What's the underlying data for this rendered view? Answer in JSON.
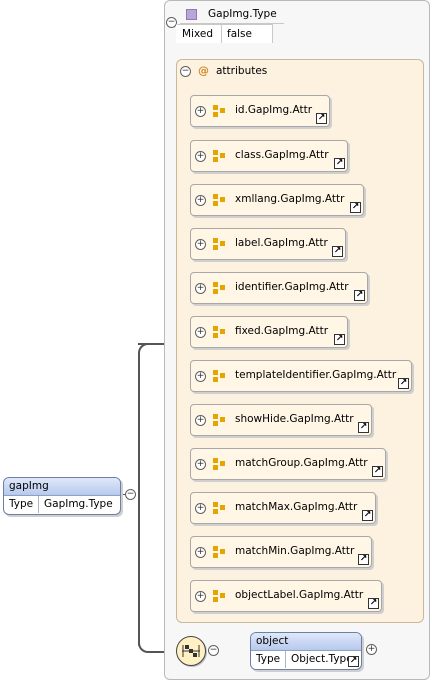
{
  "type_box": {
    "title": "GapImg.Type",
    "mixed_label": "Mixed",
    "mixed_value": "false"
  },
  "attributes": {
    "header": "attributes",
    "at_symbol": "@",
    "items": [
      "id.GapImg.Attr",
      "class.GapImg.Attr",
      "xmllang.GapImg.Attr",
      "label.GapImg.Attr",
      "identifier.GapImg.Attr",
      "fixed.GapImg.Attr",
      "templateIdentifier.GapImg.Attr",
      "showHide.GapImg.Attr",
      "matchGroup.GapImg.Attr",
      "matchMax.GapImg.Attr",
      "matchMin.GapImg.Attr",
      "objectLabel.GapImg.Attr"
    ]
  },
  "root_element": {
    "name": "gapImg",
    "type_label": "Type",
    "type_value": "GapImg.Type"
  },
  "child_element": {
    "name": "object",
    "type_label": "Type",
    "type_value": "Object.Type"
  },
  "symbols": {
    "collapse": "−",
    "expand": "+",
    "link": "↗"
  },
  "colors": {
    "attr_icon": "#e5a500",
    "element_header": "#b7c9ec",
    "type_swatch": "#b9a6d8"
  }
}
